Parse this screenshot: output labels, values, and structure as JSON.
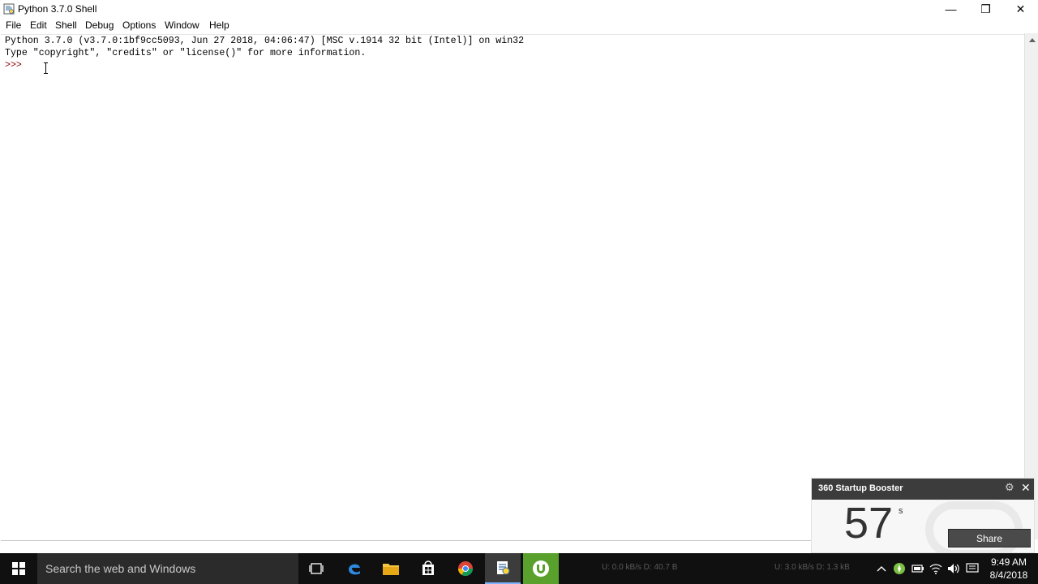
{
  "window": {
    "title": "Python 3.7.0 Shell",
    "min_glyph": "—",
    "max_glyph": "❐",
    "close_glyph": "✕"
  },
  "menu": {
    "items": [
      "File",
      "Edit",
      "Shell",
      "Debug",
      "Options",
      "Window",
      "Help"
    ]
  },
  "shell": {
    "banner_line1": "Python 3.7.0 (v3.7.0:1bf9cc5093, Jun 27 2018, 04:06:47) [MSC v.1914 32 bit (Intel)] on win32",
    "banner_line2": "Type \"copyright\", \"credits\" or \"license()\" for more information.",
    "prompt": ">>>"
  },
  "taskbar": {
    "search_placeholder": "Search the web and Windows",
    "net_left": "U: 0.0 kB/s  D: 40.7 B",
    "net_right": "U: 3.0 kB/s  D: 1.3 kB",
    "time": "9:49 AM",
    "date": "8/4/2018",
    "icons": [
      "task-view-icon",
      "edge-icon",
      "file-explorer-icon",
      "store-icon",
      "chrome-icon",
      "python-idle-icon",
      "utorrent-icon"
    ],
    "tray_icons": [
      "chevron-up-icon",
      "360-security-icon",
      "battery-icon",
      "wifi-icon",
      "volume-icon",
      "notifications-icon"
    ]
  },
  "booster": {
    "title": "360 Startup Booster",
    "seconds": "57",
    "unit": "s",
    "share_label": "Share"
  },
  "colors": {
    "prompt": "#8b0000",
    "taskbar": "#101010",
    "utorrent": "#5aa02c"
  }
}
